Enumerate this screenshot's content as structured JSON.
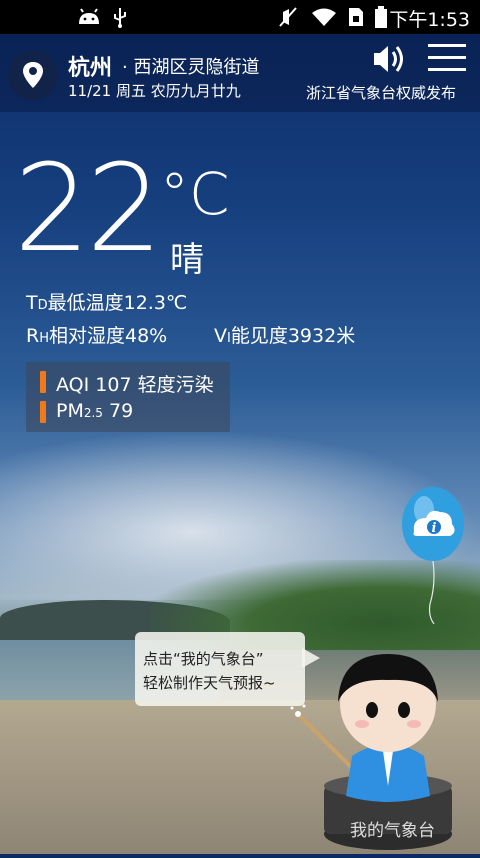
{
  "status_bar": {
    "time": "下午1:53"
  },
  "header": {
    "city": "杭州",
    "district": "· 西湖区灵隐街道",
    "date_line": "11/21 周五  农历九月廿九",
    "publisher": "浙江省气象台权威发布"
  },
  "weather": {
    "temperature": "22",
    "unit": "°C",
    "condition": "晴",
    "min_temp_prefix": "T",
    "min_temp_sub": "D",
    "min_temp_text": "最低温度12.3℃",
    "humidity_prefix": "R",
    "humidity_sub": "H",
    "humidity_text": "相对湿度48%",
    "visibility_prefix": "V",
    "visibility_sub": "I",
    "visibility_text": "能见度3932米"
  },
  "air": {
    "aqi_text": "AQI 107 轻度污染",
    "pm_label": "PM",
    "pm_sub": "2.5",
    "pm_value": "79",
    "indicator_color": "#f07a1a"
  },
  "promo": {
    "line1": "点击“我的气象台”",
    "line2": "轻松制作天气预报~",
    "mascot_label": "我的气象台"
  },
  "icons": [
    "android-icon",
    "usb-icon",
    "mute-icon",
    "wifi-icon",
    "sim-icon",
    "battery-icon",
    "location-icon",
    "speaker-icon",
    "menu-icon",
    "info-balloon-icon"
  ]
}
